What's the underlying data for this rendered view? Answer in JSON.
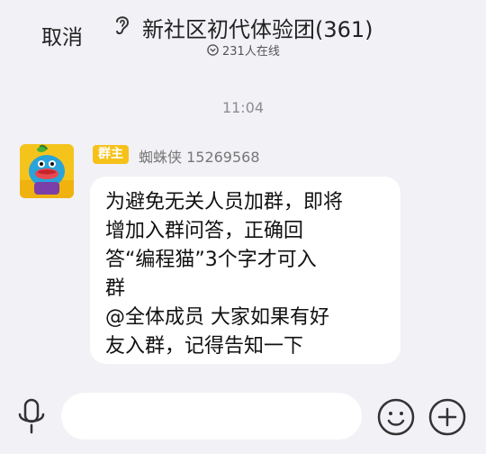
{
  "header": {
    "cancel_label": "取消",
    "title": "新社区初代体验团(361)",
    "online_text": "231人在线",
    "icons": [
      "ear-icon",
      "online-status-icon"
    ]
  },
  "chat": {
    "timestamp": "11:04",
    "message": {
      "role_badge": "群主",
      "sender": "蜘蛛侠 15269568",
      "lines": [
        "为避免无关人员加群，即将",
        "增加入群问答，正确回",
        "答“编程猫”3个字才可入",
        "群",
        "@全体成员 大家如果有好",
        "友入群，记得告知一下"
      ]
    }
  },
  "input_bar": {
    "placeholder": "",
    "icons": [
      "microphone-icon",
      "emoji-icon",
      "plus-icon"
    ]
  },
  "colors": {
    "background": "#f1f1f6",
    "badge": "#f6c21a",
    "bubble": "#ffffff",
    "avatar_bg": "#f5c41c",
    "avatar_character": "#2aa3d8"
  }
}
